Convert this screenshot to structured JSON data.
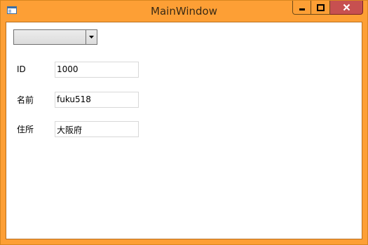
{
  "window": {
    "title": "MainWindow"
  },
  "combo": {
    "selected_value": ""
  },
  "form": {
    "fields": [
      {
        "label": "ID",
        "value": "1000"
      },
      {
        "label": "名前",
        "value": "fuku518"
      },
      {
        "label": "住所",
        "value": "大阪府"
      }
    ]
  }
}
